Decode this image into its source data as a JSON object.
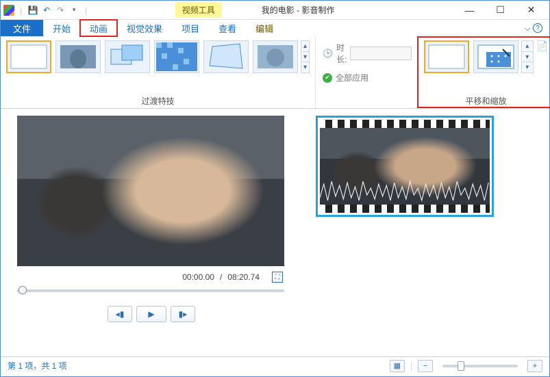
{
  "titlebar": {
    "contextual_label": "视频工具",
    "doc_title": "我的电影",
    "app_name": "影音制作",
    "separator": " - "
  },
  "qat": {
    "save": "💾",
    "undo": "↶",
    "redo": "↷",
    "more": "▾"
  },
  "colors": {
    "accent": "#1a6fc9",
    "highlight": "#e02424",
    "contextual_bg": "#fff799"
  },
  "tabs": {
    "file": "文件",
    "start": "开始",
    "animation": "动画",
    "effects": "视觉效果",
    "project": "项目",
    "view": "查看",
    "edit": "编辑"
  },
  "ribbon": {
    "transitions_group": "过渡特技",
    "pan_zoom_group": "平移和缩放",
    "duration_label": "时长:",
    "duration_value": "",
    "apply_all": "全部应用"
  },
  "player": {
    "time_current": "00:00.00",
    "time_total": "08:20.74",
    "time_sep": "/"
  },
  "status": {
    "text": "第 1 项，共 1 项"
  },
  "icons": {
    "minimize": "—",
    "maximize": "☐",
    "close": "✕",
    "chevron_down": "⌵",
    "help": "?",
    "clock": "🕒",
    "apply": "✔",
    "fullscreen": "⛶",
    "prev": "◂▮",
    "play": "▶",
    "next": "▮▸",
    "view1": "▦",
    "minus": "−",
    "plus": "+",
    "up": "▴",
    "down": "▾",
    "dropdown": "▾"
  }
}
